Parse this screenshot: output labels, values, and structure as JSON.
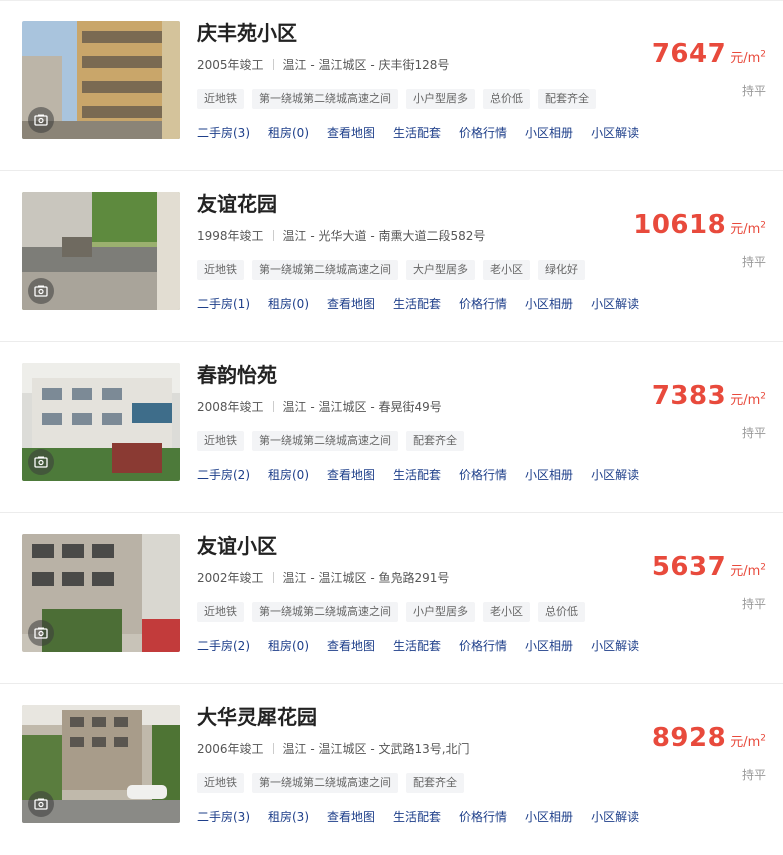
{
  "listings": [
    {
      "name": "庆丰苑小区",
      "year": "2005年竣工",
      "location": "温江 - 温江城区 - 庆丰街128号",
      "tags": [
        "近地铁",
        "第一绕城第二绕城高速之间",
        "小户型居多",
        "总价低",
        "配套齐全"
      ],
      "links": [
        "二手房(3)",
        "租房(0)",
        "查看地图",
        "生活配套",
        "价格行情",
        "小区相册",
        "小区解读"
      ],
      "price": "7647",
      "unit": "元/m",
      "unit_sup": "2",
      "hold_label": "持平"
    },
    {
      "name": "友谊花园",
      "year": "1998年竣工",
      "location": "温江 - 光华大道 - 南熏大道二段582号",
      "tags": [
        "近地铁",
        "第一绕城第二绕城高速之间",
        "大户型居多",
        "老小区",
        "绿化好"
      ],
      "links": [
        "二手房(1)",
        "租房(0)",
        "查看地图",
        "生活配套",
        "价格行情",
        "小区相册",
        "小区解读"
      ],
      "price": "10618",
      "unit": "元/m",
      "unit_sup": "2",
      "hold_label": "持平"
    },
    {
      "name": "春韵怡苑",
      "year": "2008年竣工",
      "location": "温江 - 温江城区 - 春晃街49号",
      "tags": [
        "近地铁",
        "第一绕城第二绕城高速之间",
        "配套齐全"
      ],
      "links": [
        "二手房(2)",
        "租房(0)",
        "查看地图",
        "生活配套",
        "价格行情",
        "小区相册",
        "小区解读"
      ],
      "price": "7383",
      "unit": "元/m",
      "unit_sup": "2",
      "hold_label": "持平"
    },
    {
      "name": "友谊小区",
      "year": "2002年竣工",
      "location": "温江 - 温江城区 - 鱼凫路291号",
      "tags": [
        "近地铁",
        "第一绕城第二绕城高速之间",
        "小户型居多",
        "老小区",
        "总价低"
      ],
      "links": [
        "二手房(2)",
        "租房(0)",
        "查看地图",
        "生活配套",
        "价格行情",
        "小区相册",
        "小区解读"
      ],
      "price": "5637",
      "unit": "元/m",
      "unit_sup": "2",
      "hold_label": "持平"
    },
    {
      "name": "大华灵犀花园",
      "year": "2006年竣工",
      "location": "温江 - 温江城区 - 文武路13号,北门",
      "tags": [
        "近地铁",
        "第一绕城第二绕城高速之间",
        "配套齐全"
      ],
      "links": [
        "二手房(3)",
        "租房(3)",
        "查看地图",
        "生活配套",
        "价格行情",
        "小区相册",
        "小区解读"
      ],
      "price": "8928",
      "unit": "元/m",
      "unit_sup": "2",
      "hold_label": "持平"
    }
  ],
  "colors": {
    "price": "#e84a3c",
    "link": "#1e3f8a",
    "tag_bg": "#f3f4f6"
  },
  "icons": {
    "photo_badge": "camera-icon"
  }
}
